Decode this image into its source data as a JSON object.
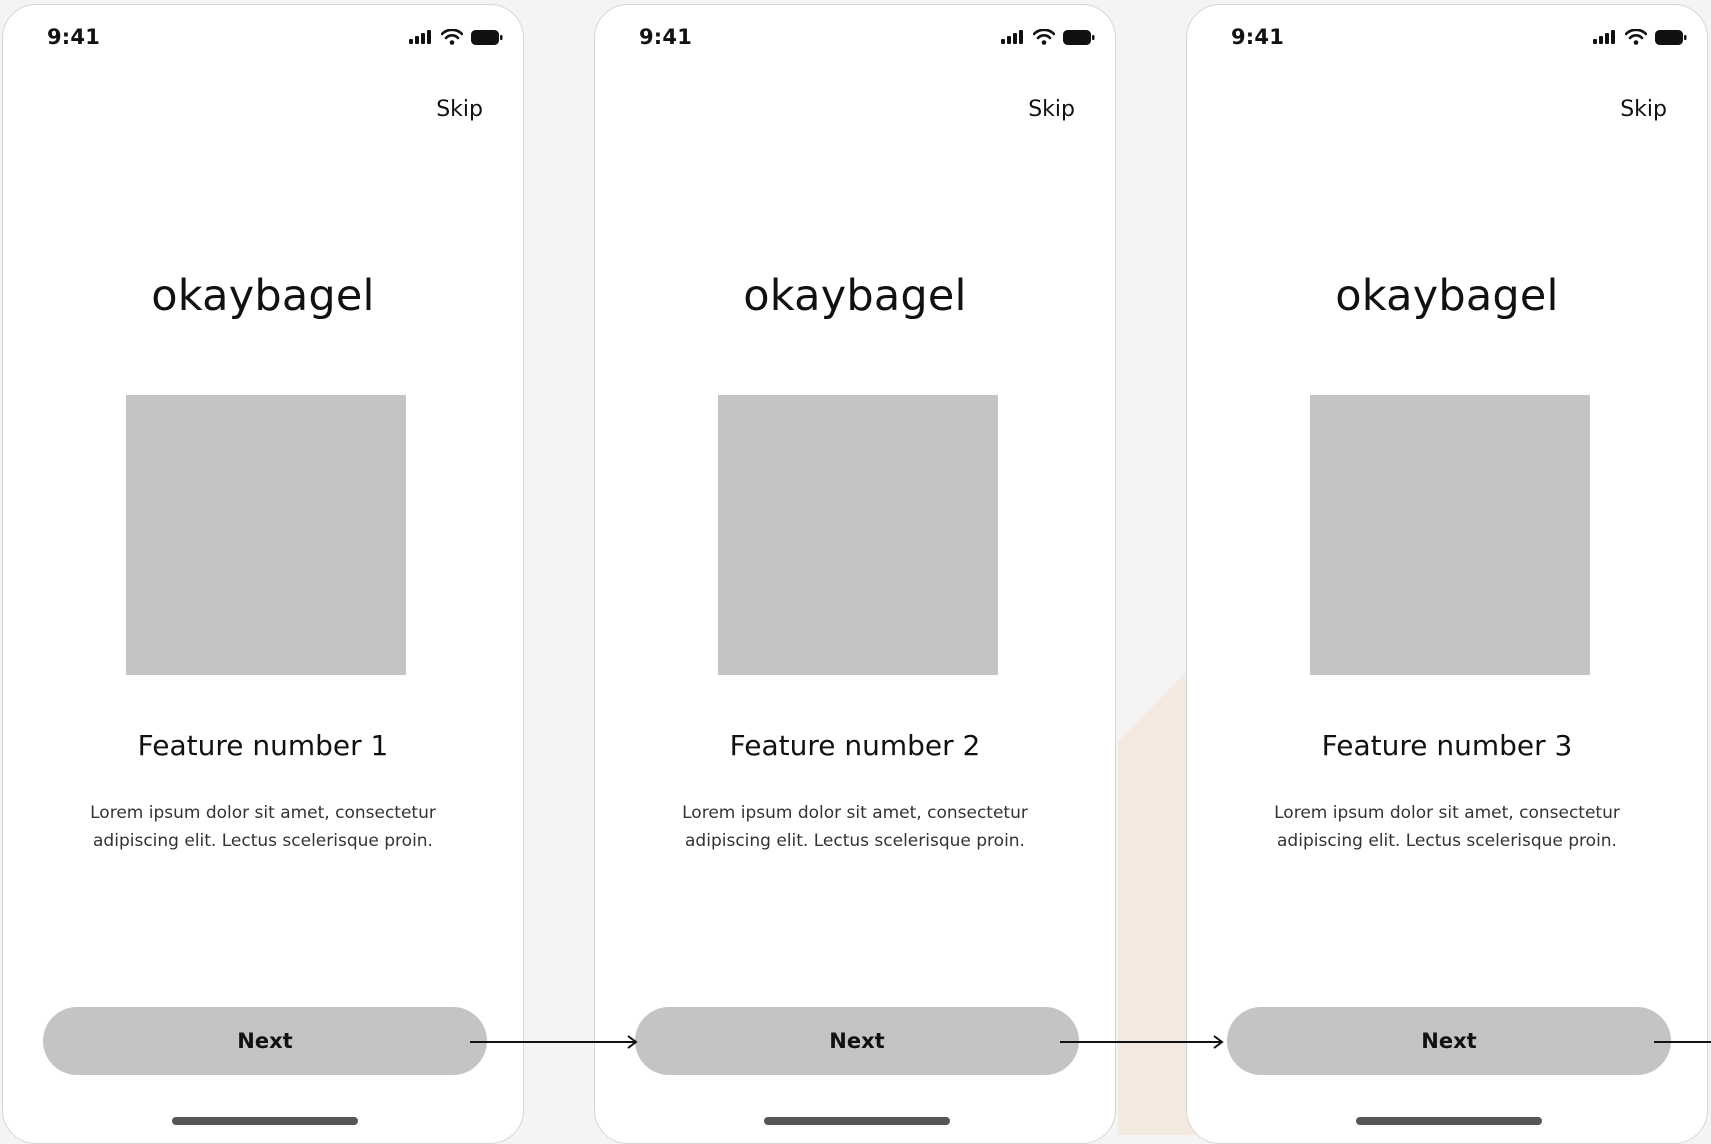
{
  "colors": {
    "page_background": "#f4f4f4",
    "screen_background": "#ffffff",
    "placeholder": "#c4c4c4",
    "button": "#c4c4c4",
    "accent": "#f3e9df",
    "text": "#111111"
  },
  "status_bar": {
    "time": "9:41",
    "icons": [
      "signal-icon",
      "wifi-icon",
      "battery-icon"
    ]
  },
  "screens": [
    {
      "skip_label": "Skip",
      "brand": "okaybagel",
      "feature_title": "Feature number 1",
      "feature_description": "Lorem ipsum dolor sit amet, consectetur adipiscing elit. Lectus scelerisque proin.",
      "next_label": "Next"
    },
    {
      "skip_label": "Skip",
      "brand": "okaybagel",
      "feature_title": "Feature number 2",
      "feature_description": "Lorem ipsum dolor sit amet, consectetur adipiscing elit. Lectus scelerisque proin.",
      "next_label": "Next"
    },
    {
      "skip_label": "Skip",
      "brand": "okaybagel",
      "feature_title": "Feature number 3",
      "feature_description": "Lorem ipsum dolor sit amet, consectetur adipiscing elit. Lectus scelerisque proin.",
      "next_label": "Next"
    }
  ]
}
